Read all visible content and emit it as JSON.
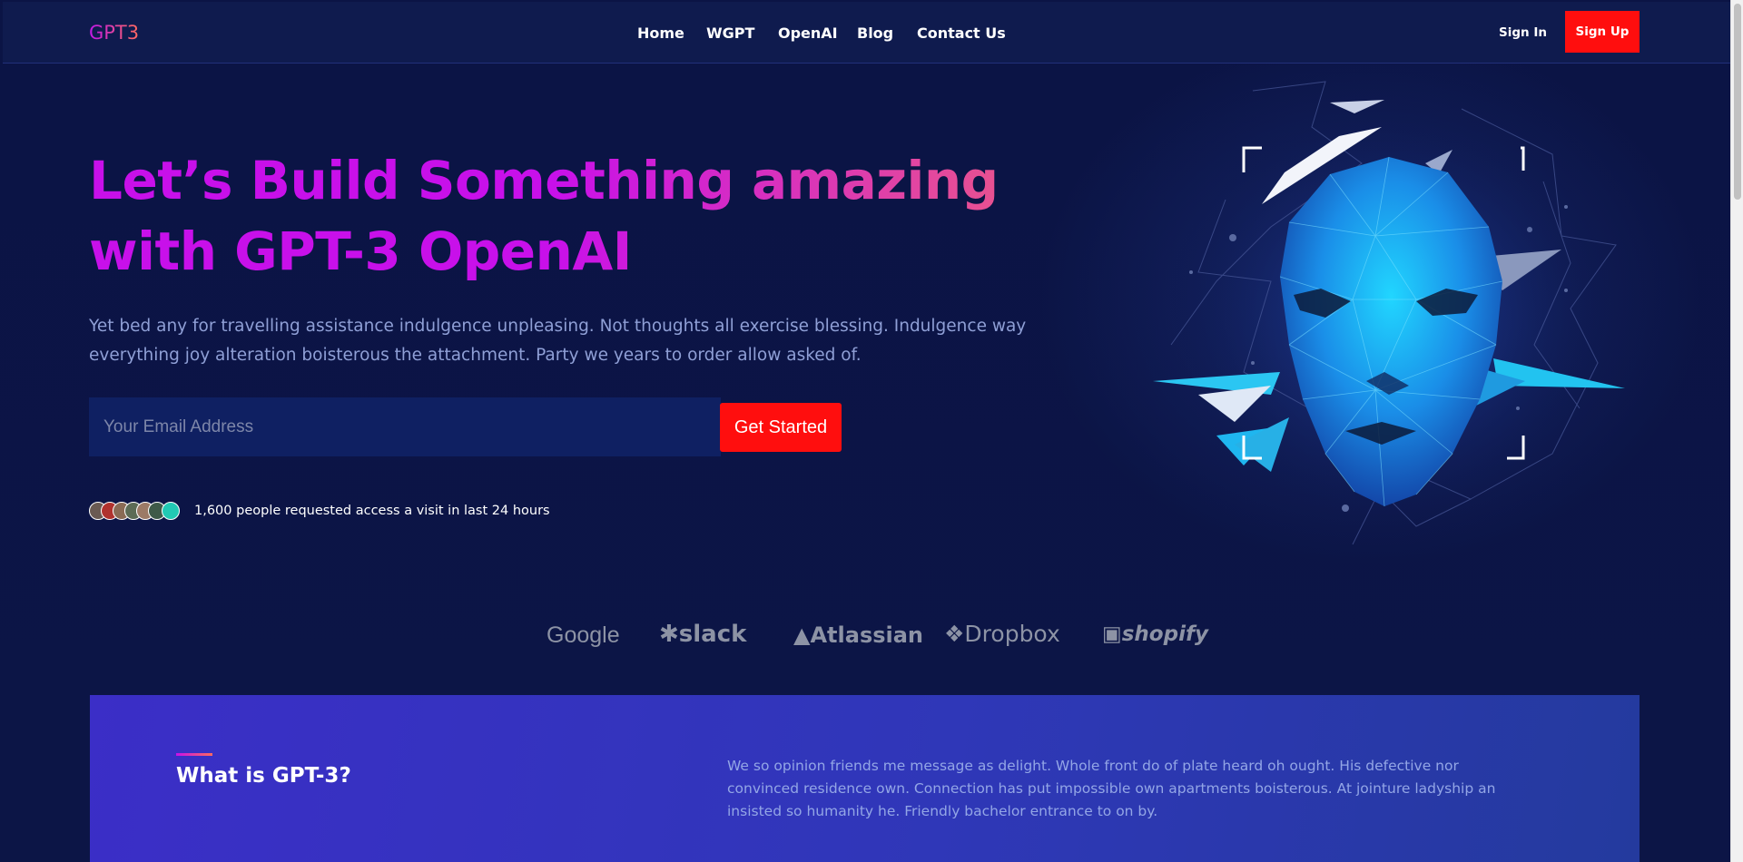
{
  "nav": {
    "logo": "GPT3",
    "links": [
      "Home",
      "WGPT",
      "OpenAI",
      "Blog",
      "Contact Us"
    ],
    "sign_in": "Sign In",
    "sign_up": "Sign Up"
  },
  "hero": {
    "headline": "Let’s Build Something amazing with GPT-3 OpenAI",
    "subtext": "Yet bed any for travelling assistance indulgence unpleasing. Not thoughts all exercise blessing. Indulgence way everything joy alteration boisterous the attachment. Party we years to order allow asked of.",
    "email_placeholder": "Your Email Address",
    "cta": "Get Started",
    "social_proof": "1,600 people requested access a visit in last 24 hours"
  },
  "brands": [
    "Google",
    "slack",
    "Atlassian",
    "Dropbox",
    "shopify"
  ],
  "what": {
    "title": "What is GPT-3?",
    "text": "We so opinion friends me message as delight. Whole front do of plate heard oh ought. His defective nor convinced residence own. Connection has put impossible own apartments boisterous. At jointure ladyship an insisted so humanity he. Friendly bachelor entrance to on by."
  },
  "colors": {
    "background": "#0b1445",
    "accent_red": "#ff0e0e",
    "gradient_start": "#c810ea",
    "gradient_end": "#ff6a5e",
    "section_blue": "#3b2ec7"
  }
}
